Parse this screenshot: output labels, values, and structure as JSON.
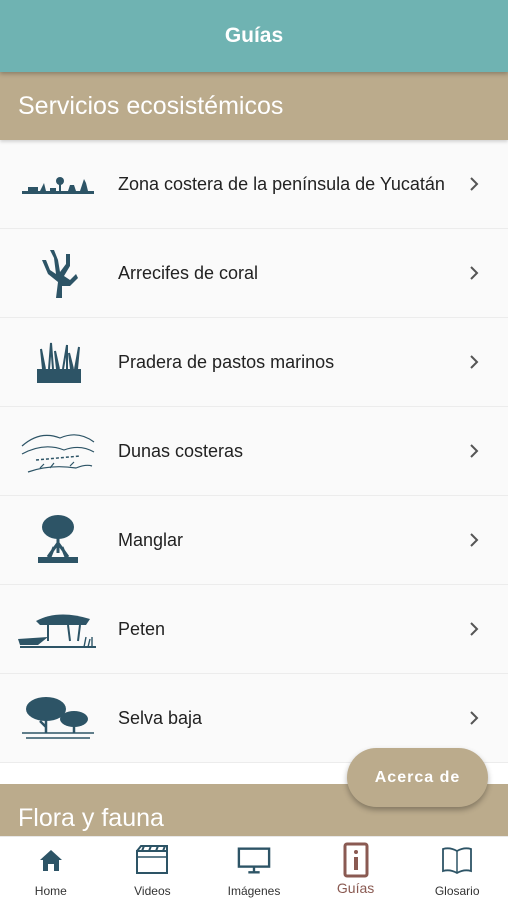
{
  "appbar": {
    "title": "Guías"
  },
  "sections": [
    {
      "title": "Servicios ecosistémicos"
    },
    {
      "title": "Flora y fauna"
    }
  ],
  "guides": [
    {
      "label": "Zona costera de la península de Yucatán",
      "icon": "coastal-zone-icon"
    },
    {
      "label": "Arrecifes de coral",
      "icon": "coral-icon"
    },
    {
      "label": "Pradera de pastos marinos",
      "icon": "seagrass-icon"
    },
    {
      "label": "Dunas costeras",
      "icon": "dunes-icon"
    },
    {
      "label": "Manglar",
      "icon": "mangrove-icon"
    },
    {
      "label": "Peten",
      "icon": "peten-icon"
    },
    {
      "label": "Selva baja",
      "icon": "low-forest-icon"
    }
  ],
  "fab": {
    "label": "Acerca de"
  },
  "nav": [
    {
      "label": "Home",
      "icon": "home-icon"
    },
    {
      "label": "Videos",
      "icon": "film-icon"
    },
    {
      "label": "Imágenes",
      "icon": "monitor-icon"
    },
    {
      "label": "Guías",
      "icon": "info-icon",
      "active": true
    },
    {
      "label": "Glosario",
      "icon": "book-icon"
    }
  ],
  "colors": {
    "appbar": "#6fb3b2",
    "section": "#bbab8c",
    "icon": "#2d5466",
    "active": "#8a5a52"
  }
}
